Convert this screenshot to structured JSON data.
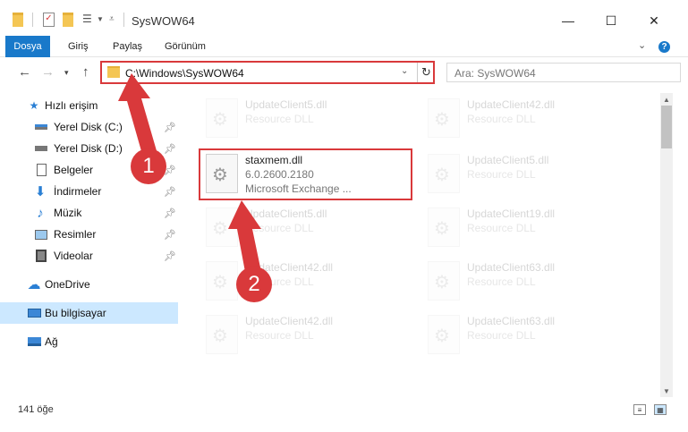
{
  "window": {
    "title": "SysWOW64",
    "minimize": "—",
    "maximize": "☐",
    "close": "✕"
  },
  "ribbon": {
    "file_tab": "Dosya",
    "tabs": [
      "Giriş",
      "Paylaş",
      "Görünüm"
    ],
    "help": "?"
  },
  "address": {
    "path": "C:\\Windows\\SysWOW64",
    "search_placeholder": "Ara: SysWOW64"
  },
  "sidebar": {
    "items": [
      {
        "label": "Hızlı erişim",
        "icon": "star-icon"
      },
      {
        "label": "Yerel Disk (C:)",
        "icon": "drive-icon"
      },
      {
        "label": "Yerel Disk (D:)",
        "icon": "drive-icon"
      },
      {
        "label": "Belgeler",
        "icon": "documents-icon"
      },
      {
        "label": "İndirmeler",
        "icon": "download-icon"
      },
      {
        "label": "Müzik",
        "icon": "music-icon"
      },
      {
        "label": "Resimler",
        "icon": "pictures-icon"
      },
      {
        "label": "Videolar",
        "icon": "video-icon"
      },
      {
        "label": "OneDrive",
        "icon": "cloud-icon"
      },
      {
        "label": "Bu bilgisayar",
        "icon": "computer-icon"
      },
      {
        "label": "Ağ",
        "icon": "network-icon"
      }
    ]
  },
  "files": [
    {
      "name": "UpdateClient5.dll",
      "desc": "Resource DLL"
    },
    {
      "name": "UpdateClient42.dll",
      "desc": "Resource DLL"
    },
    {
      "name": "staxmem.dll",
      "desc": "6.0.2600.2180",
      "desc2": "Microsoft Exchange ..."
    },
    {
      "name": "UpdateClient5.dll",
      "desc": "Resource DLL"
    },
    {
      "name": "UpdateClient5.dll",
      "desc": "Resource DLL"
    },
    {
      "name": "UpdateClient19.dll",
      "desc": "Resource DLL"
    },
    {
      "name": "UpdateClient42.dll",
      "desc": "Resource DLL"
    },
    {
      "name": "UpdateClient63.dll",
      "desc": "Resource DLL"
    },
    {
      "name": "UpdateClient42.dll",
      "desc": "Resource DLL"
    },
    {
      "name": "UpdateClient63.dll",
      "desc": "Resource DLL"
    }
  ],
  "status": {
    "count": "141 öğe"
  },
  "annotations": {
    "step1": "1",
    "step2": "2",
    "accent_color": "#d9393b"
  }
}
